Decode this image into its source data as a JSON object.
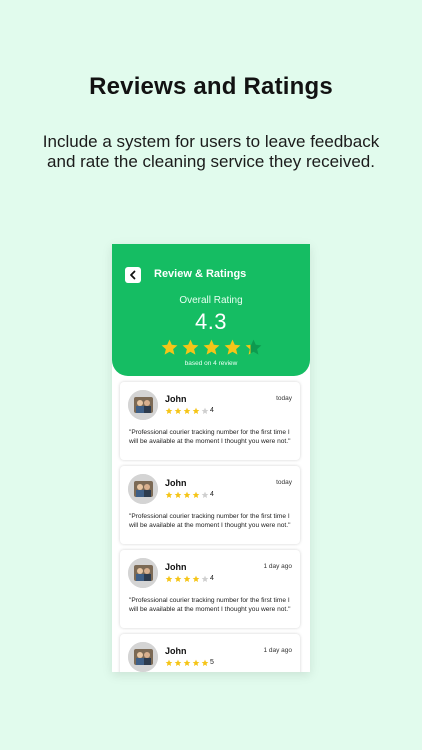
{
  "headline": "Reviews and Ratings",
  "subtitle": "Include a system for users to leave feedback and rate the cleaning service they received.",
  "app": {
    "title": "Review & Ratings",
    "overall_label": "Overall Rating",
    "overall_value": "4.3",
    "overall_stars": 4.3,
    "based_on": "based on 4 review",
    "accent": "#15bd63",
    "star_color": "#f5c518"
  },
  "reviews": [
    {
      "name": "John",
      "date": "today",
      "rating": 4,
      "rating_label": "4",
      "text": "\"Professional courier tracking number for the first time I will be available at the moment I thought you were not.\""
    },
    {
      "name": "John",
      "date": "today",
      "rating": 4,
      "rating_label": "4",
      "text": "\"Professional courier tracking number for the first time I will be available at the moment I thought you were not.\""
    },
    {
      "name": "John",
      "date": "1 day ago",
      "rating": 4,
      "rating_label": "4",
      "text": "\"Professional courier tracking number for the first time I will be available at the moment I thought you were not.\""
    },
    {
      "name": "John",
      "date": "1 day ago",
      "rating": 5,
      "rating_label": "5",
      "text": ""
    }
  ]
}
